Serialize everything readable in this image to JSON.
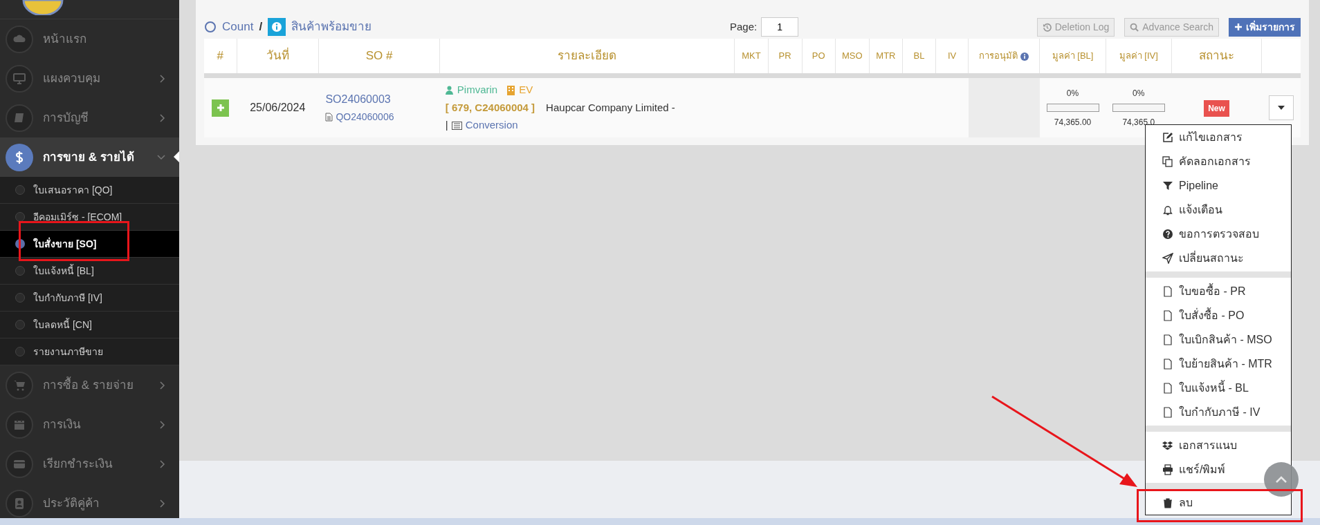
{
  "sidebar": {
    "items": [
      {
        "label": "หน้าแรก",
        "selected": false
      },
      {
        "label": "แผงควบคุม",
        "expanded": false,
        "selected": false
      },
      {
        "label": "การบัญชี",
        "expanded": false,
        "selected": false
      },
      {
        "label": "การขาย & รายได้",
        "expanded": true,
        "selected": true,
        "children": [
          {
            "label": "ใบเสนอราคา [QO]",
            "selected": false
          },
          {
            "label": "อีคอมเมิร์ซ - [ECOM]",
            "selected": false
          },
          {
            "label": "ใบสั่งขาย [SO]",
            "selected": true
          },
          {
            "label": "ใบแจ้งหนี้ [BL]",
            "selected": false
          },
          {
            "label": "ใบกำกับภาษี [IV]",
            "selected": false
          },
          {
            "label": "ใบลดหนี้ [CN]",
            "selected": false
          },
          {
            "label": "รายงานภาษีขาย",
            "selected": false
          }
        ]
      },
      {
        "label": "การซื้อ & รายจ่าย",
        "expanded": false,
        "selected": false
      },
      {
        "label": "การเงิน",
        "expanded": false,
        "selected": false
      },
      {
        "label": "เรียกชำระเงิน",
        "expanded": false,
        "selected": false
      },
      {
        "label": "ประวัติคู่ค้า",
        "expanded": false,
        "selected": false
      }
    ]
  },
  "toolbar": {
    "breadcrumb": [
      "Count",
      "/",
      "สินค้าพร้อมขาย"
    ],
    "page_label": "Page:",
    "page_value": "1",
    "buttons": [
      {
        "label": "Deletion Log",
        "kind": "log"
      },
      {
        "label": "Advance Search",
        "kind": "search"
      },
      {
        "label": "เพิ่มรายการ",
        "kind": "add"
      }
    ]
  },
  "table": {
    "columns": [
      "#",
      "วันที่",
      "SO #",
      "รายละเอียด",
      "MKT",
      "PR",
      "PO",
      "MSO",
      "MTR",
      "BL",
      "IV",
      "การอนุมัติ",
      "มูลค่า [BL]",
      "มูลค่า [IV]",
      "สถานะ"
    ],
    "rows": [
      {
        "date": "25/06/2024",
        "so": "SO24060003",
        "qo": "QO24060006",
        "salesperson": "Pimvarin",
        "branch": "EV",
        "code": "[ 679, C24060004 ]",
        "customer": "Haupcar Company Limited -",
        "separator": "|",
        "channel": "Conversion",
        "bl": {
          "percent": "0%",
          "level": 0,
          "amount": "74,365.00"
        },
        "iv": {
          "percent": "0%",
          "level": 0,
          "amount": "74,365.0"
        },
        "status": {
          "label": "New",
          "color": "#e9524f"
        }
      }
    ]
  },
  "row_menu": {
    "items": [
      {
        "kind": "item",
        "label": "แก้ไขเอกสาร"
      },
      {
        "kind": "item",
        "label": "คัดลอกเอกสาร"
      },
      {
        "kind": "item",
        "label": "Pipeline"
      },
      {
        "kind": "item",
        "label": "แจ้งเตือน"
      },
      {
        "kind": "item",
        "label": "ขอการตรวจสอบ"
      },
      {
        "kind": "item",
        "label": "เปลี่ยนสถานะ"
      },
      {
        "kind": "separator"
      },
      {
        "kind": "item",
        "label": "ใบขอซื้อ - PR"
      },
      {
        "kind": "item",
        "label": "ใบสั่งซื้อ - PO"
      },
      {
        "kind": "item",
        "label": "ใบเบิกสินค้า - MSO"
      },
      {
        "kind": "item",
        "label": "ใบย้ายสินค้า - MTR"
      },
      {
        "kind": "item",
        "label": "ใบแจ้งหนี้ - BL"
      },
      {
        "kind": "item",
        "label": "ใบกำกับภาษี - IV"
      },
      {
        "kind": "separator"
      },
      {
        "kind": "item",
        "label": "เอกสารแนบ"
      },
      {
        "kind": "item",
        "label": "แชร์/พิมพ์"
      },
      {
        "kind": "separator"
      },
      {
        "kind": "item",
        "label": "ลบ"
      }
    ]
  }
}
